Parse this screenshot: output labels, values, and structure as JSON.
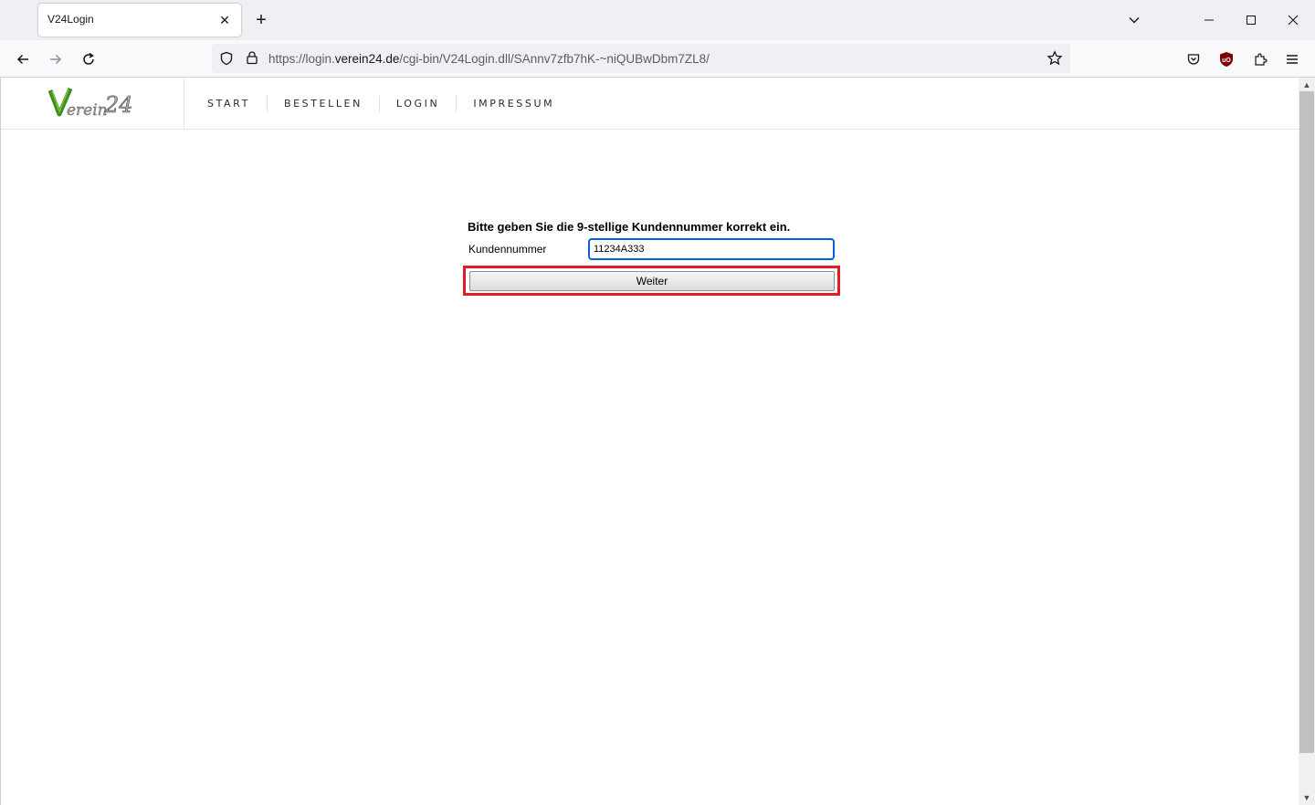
{
  "browser": {
    "tab_title": "V24Login",
    "url_prefix": "https://login.",
    "url_host": "verein24.de",
    "url_path": "/cgi-bin/V24Login.dll/SAnnv7zfb7hK-~niQUBwDbm7ZL8/"
  },
  "site": {
    "logo_text": "Verein 24",
    "nav": [
      "START",
      "BESTELLEN",
      "LOGIN",
      "IMPRESSUM"
    ]
  },
  "form": {
    "instruction": "Bitte geben Sie die 9-stellige Kundennummer korrekt ein.",
    "label": "Kundennummer",
    "value": "11234A333",
    "button": "Weiter"
  },
  "colors": {
    "highlight": "#e31c23",
    "focus": "#0060df",
    "logo_green": "#3a8f1e"
  }
}
